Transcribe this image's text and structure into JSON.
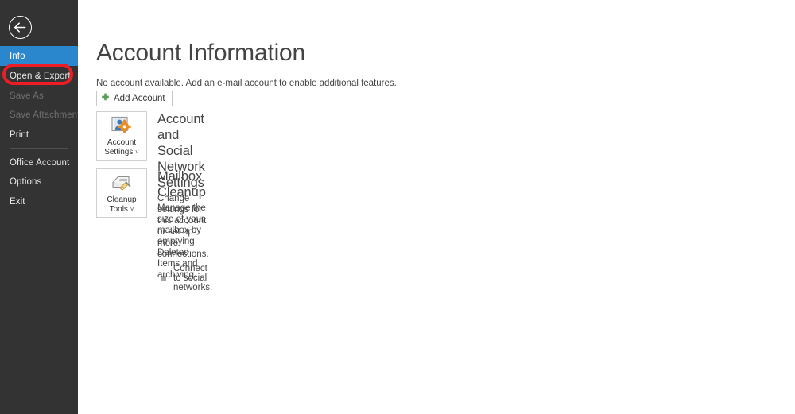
{
  "colors": {
    "sidebar_bg": "#333333",
    "selected_blue": "#2b87cd",
    "selected_edge": "#8ec8ee",
    "annotation_red": "#ee1c24",
    "text_light": "#e9e9e9",
    "text_disabled": "#6e6e6e",
    "heading_gray": "#444444",
    "plus_green": "#5b9b5b",
    "icon_blue": "#3e7cb8",
    "icon_orange": "#ed8b22"
  },
  "sidebar": {
    "back_button": {
      "name": "back-arrow-icon",
      "label": "Back"
    },
    "items": [
      {
        "label": "Info",
        "state": "selected"
      },
      {
        "label": "Open & Export",
        "state": "normal"
      },
      {
        "label": "Save As",
        "state": "disabled"
      },
      {
        "label": "Save Attachments",
        "state": "disabled"
      },
      {
        "label": "Print",
        "state": "normal"
      },
      {
        "label": "Office Account",
        "state": "normal"
      },
      {
        "label": "Options",
        "state": "normal"
      },
      {
        "label": "Exit",
        "state": "normal"
      }
    ]
  },
  "annotation": {
    "shape": "rounded-rectangle",
    "color": "#ee1c24",
    "targets": "Open & Export"
  },
  "main": {
    "page_title": "Account Information",
    "no_account_text": "No account available. Add an e-mail account to enable additional features.",
    "add_account_button": {
      "label": "Add Account",
      "icon": "plus-icon"
    },
    "sections": [
      {
        "button": {
          "label_line1": "Account",
          "label_line2": "Settings",
          "caret": "˅",
          "icon": "account-settings-icon"
        },
        "heading": "Account and Social Network Settings",
        "description": "Change settings for this account or set up more connections.",
        "bullets": [
          "Connect to social networks."
        ]
      },
      {
        "button": {
          "label_line1": "Cleanup",
          "label_line2": "Tools",
          "caret": "˅",
          "icon": "cleanup-tools-icon"
        },
        "heading": "Mailbox Cleanup",
        "description": "Manage the size of your mailbox by emptying Deleted Items and archiving.",
        "bullets": []
      }
    ]
  }
}
